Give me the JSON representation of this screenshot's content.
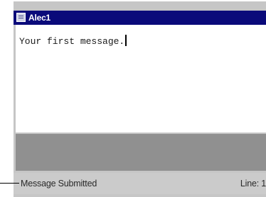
{
  "window": {
    "title": "Alec1",
    "icon": "window-icon"
  },
  "editor": {
    "text": "Your first message."
  },
  "status_bar": {
    "message": "Message Submitted",
    "line": "Line: 1"
  }
}
